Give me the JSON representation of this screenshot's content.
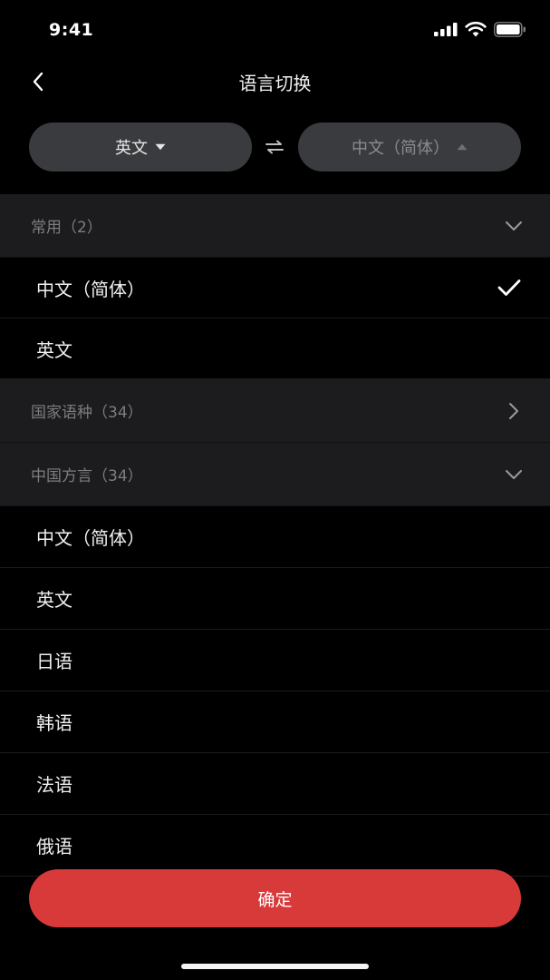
{
  "status_bar": {
    "time": "9:41"
  },
  "nav": {
    "title": "语言切换"
  },
  "selector": {
    "source_label": "英文",
    "target_label": "中文（简体）"
  },
  "sections": {
    "common": {
      "label": "常用（2）",
      "items": [
        "中文（简体）",
        "英文"
      ],
      "selected_index": 0
    },
    "countries": {
      "label": "国家语种（34）"
    },
    "dialects": {
      "label": "中国方言（34）",
      "items": [
        "中文（简体）",
        "英文",
        "日语",
        "韩语",
        "法语",
        "俄语"
      ]
    }
  },
  "confirm": {
    "label": "确定"
  },
  "colors": {
    "background": "#000000",
    "pill": "#3a3b3e",
    "section_header": "#1c1c1e",
    "accent_red": "#d83a3a"
  },
  "icons": {
    "back": "chevron-left-icon",
    "swap": "swap-arrows-icon",
    "source_dropdown": "caret-down-icon",
    "target_dropdown": "caret-up-icon",
    "common_toggle": "chevron-down-icon",
    "countries_toggle": "chevron-right-icon",
    "dialects_toggle": "chevron-down-icon",
    "selected": "checkmark-icon"
  }
}
